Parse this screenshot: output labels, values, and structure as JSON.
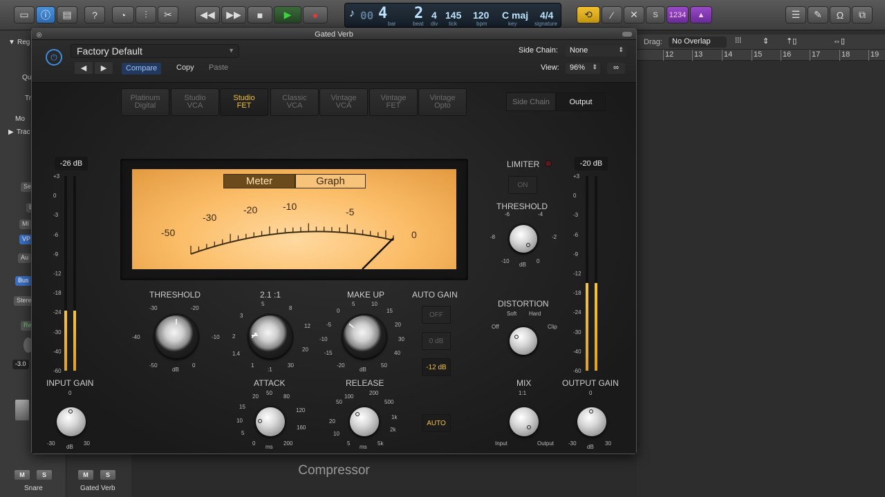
{
  "topbar": {
    "lcd": {
      "bar": "4",
      "beat": "2",
      "div": "4",
      "tick": "145",
      "bpm": "120",
      "key": "C maj",
      "signature": "4/4",
      "bar_label": "bar",
      "beat_label": "beat",
      "div_label": "div",
      "tick_label": "tick",
      "bpm_label": "bpm",
      "key_label": "key",
      "signature_label": "signature",
      "prefix": "00"
    },
    "counter_badge": "1234",
    "solo_label": "S"
  },
  "inspector": {
    "region_label": "Reg",
    "quantize_label": "Qu",
    "transpose_label": "Tr",
    "more_label": "Mo",
    "track_label": "Trac",
    "setting_btn": "Se",
    "eq_btn": "E",
    "midi_btn": "MI",
    "vp_btn": "VP",
    "audio_btn": "Au",
    "bus_btn": "Bus",
    "stereo_btn": "Stere",
    "read_btn": "Re",
    "volume_value": "-3.0",
    "channel1_name": "Snare",
    "channel2_name": "Gated Verb",
    "mute_label": "M",
    "solo_label": "S"
  },
  "tracks": {
    "drag_label": "Drag:",
    "drag_mode": "No Overlap",
    "ruler": [
      "12",
      "13",
      "14",
      "15",
      "16",
      "17",
      "18",
      "19"
    ]
  },
  "plugin": {
    "window_title": "Gated Verb",
    "preset_name": "Factory Default",
    "compare_label": "Compare",
    "copy_label": "Copy",
    "paste_label": "Paste",
    "side_chain_label": "Side Chain:",
    "side_chain_value": "None",
    "view_label": "View:",
    "view_value": "96%",
    "models": [
      {
        "line1": "Platinum",
        "line2": "Digital"
      },
      {
        "line1": "Studio",
        "line2": "VCA"
      },
      {
        "line1": "Studio",
        "line2": "FET"
      },
      {
        "line1": "Classic",
        "line2": "VCA"
      },
      {
        "line1": "Vintage",
        "line2": "VCA"
      },
      {
        "line1": "Vintage",
        "line2": "FET"
      },
      {
        "line1": "Vintage",
        "line2": "Opto"
      }
    ],
    "active_model": "Studio FET",
    "sidechain_tab": "Side Chain",
    "output_tab": "Output",
    "meter_tab": "Meter",
    "graph_tab": "Graph",
    "vu_scale": [
      "-50",
      "-30",
      "-20",
      "-10",
      "-5",
      "0"
    ],
    "input_db": "-26 dB",
    "output_db": "-20 dB",
    "meter_scale": [
      "+3",
      "0",
      "-3",
      "-6",
      "-9",
      "-12",
      "-18",
      "-24",
      "-30",
      "-40",
      "-60"
    ],
    "input_level": 0.31,
    "output_level": 0.45,
    "limiter_label": "LIMITER",
    "limiter_on_label": "ON",
    "limiter_threshold_label": "THRESHOLD",
    "limiter_threshold_scale": {
      "a": "-6",
      "b": "-4",
      "c": "-8",
      "d": "-2",
      "e": "-10",
      "f": "dB",
      "g": "0"
    },
    "threshold": {
      "label": "THRESHOLD",
      "s1": "-30",
      "s2": "-20",
      "s3": "-40",
      "s4": "-10",
      "s5": "-50",
      "s6": "dB",
      "s7": "0"
    },
    "ratio": {
      "label": "2.1 :1",
      "s1": "5",
      "s2": "3",
      "s3": "8",
      "s4": "2",
      "s5": "12",
      "s6": "1.4",
      "s7": "20",
      "s8": "1",
      "s9": ":1",
      "s10": "30"
    },
    "makeup": {
      "label": "MAKE UP",
      "s1": "5",
      "s2": "10",
      "s3": "0",
      "s4": "15",
      "s5": "-5",
      "s6": "20",
      "s7": "-10",
      "s8": "30",
      "s9": "-15",
      "s10": "40",
      "s11": "-20",
      "s12": "dB",
      "s13": "50"
    },
    "auto_gain": {
      "label": "AUTO GAIN",
      "off": "OFF",
      "zero": "0 dB",
      "minus12": "-12 dB"
    },
    "input_gain": {
      "label": "INPUT GAIN",
      "s0": "0",
      "s1": "-30",
      "s2": "dB",
      "s3": "30"
    },
    "attack": {
      "label": "ATTACK",
      "s1": "20",
      "s2": "50",
      "s3": "80",
      "s4": "15",
      "s5": "120",
      "s6": "10",
      "s7": "160",
      "s8": "5",
      "s9": "0",
      "s10": "ms",
      "s11": "200"
    },
    "release": {
      "label": "RELEASE",
      "s1": "100",
      "s2": "200",
      "s3": "50",
      "s4": "500",
      "s5": "20",
      "s6": "1k",
      "s7": "10",
      "s8": "2k",
      "s9": "5",
      "s10": "ms",
      "s11": "5k"
    },
    "auto_label": "AUTO",
    "distortion": {
      "label": "DISTORTION",
      "soft": "Soft",
      "hard": "Hard",
      "off": "Off",
      "clip": "Clip"
    },
    "mix": {
      "label": "MIX",
      "ratio": "1:1",
      "input": "Input",
      "output": "Output"
    },
    "output_gain": {
      "label": "OUTPUT GAIN",
      "s0": "0",
      "s1": "-30",
      "s2": "dB",
      "s3": "30"
    },
    "footer_name": "Compressor"
  }
}
